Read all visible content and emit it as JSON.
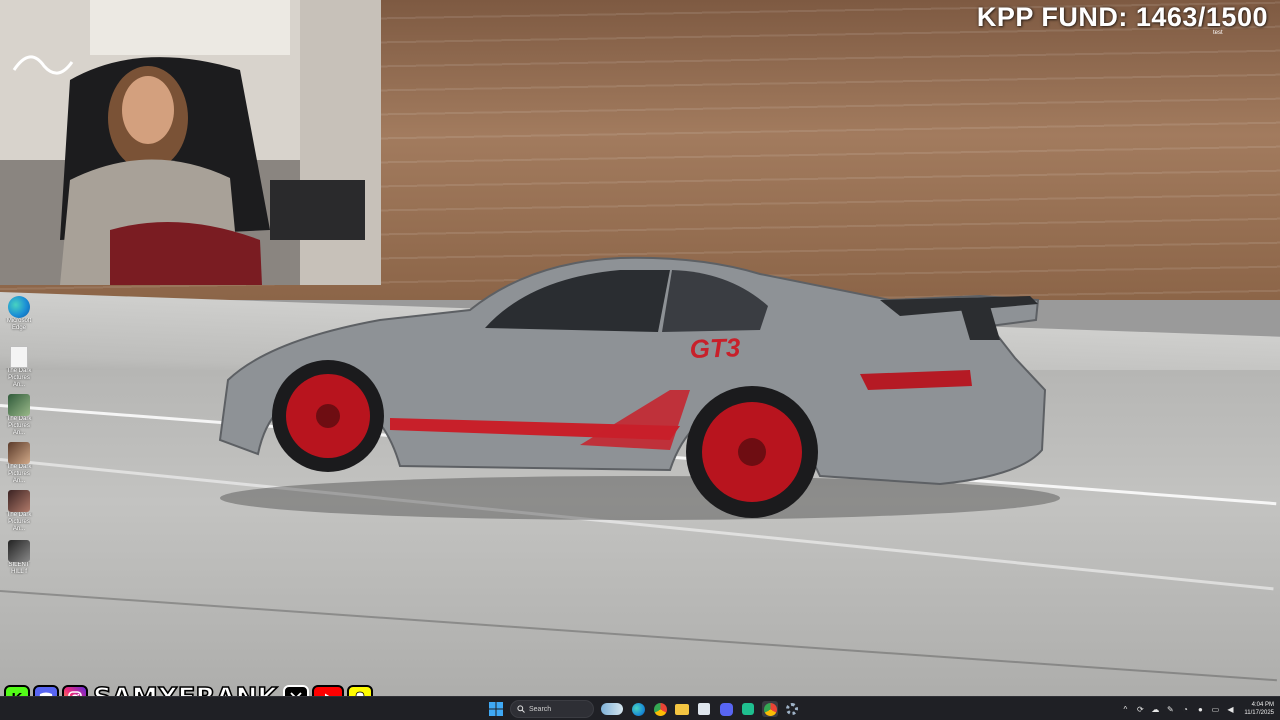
{
  "overlay": {
    "fund_text": "KPP FUND: 1463/1500",
    "fund_sub": "test"
  },
  "desktop_icons": [
    {
      "label": "Microsoft Edge",
      "icon": "edge-icon"
    },
    {
      "label": "The Dark Pictures An...",
      "icon": "file-icon"
    },
    {
      "label": "The Dark Pictures An...",
      "icon": "game-icon"
    },
    {
      "label": "The Dark Pictures An...",
      "icon": "game-icon"
    },
    {
      "label": "The Dark Pictures An...",
      "icon": "game-icon"
    },
    {
      "label": "SILENT HILL f",
      "icon": "game-icon"
    }
  ],
  "social": {
    "handle": "SAMXFRANK",
    "icons": [
      "kick-icon",
      "discord-icon",
      "instagram-icon",
      "x-icon",
      "youtube-icon",
      "snapchat-icon"
    ]
  },
  "taskbar": {
    "search_placeholder": "Search",
    "apps": [
      "start-icon",
      "search-icon",
      "widgets-icon",
      "edge-icon",
      "chrome-icon",
      "file-explorer-icon",
      "store-icon",
      "discord-icon",
      "app-icon",
      "chrome-icon",
      "settings-icon"
    ],
    "time": "4:04 PM",
    "date": "11/17/2025"
  },
  "colors": {
    "taskbar_bg": "#1f2025",
    "car_body": "#8e9296",
    "car_accent": "#c8202a",
    "kick_green": "#53fc18",
    "discord_blurple": "#5865f2",
    "youtube_red": "#ff0000",
    "snapchat_yellow": "#fffc00"
  }
}
